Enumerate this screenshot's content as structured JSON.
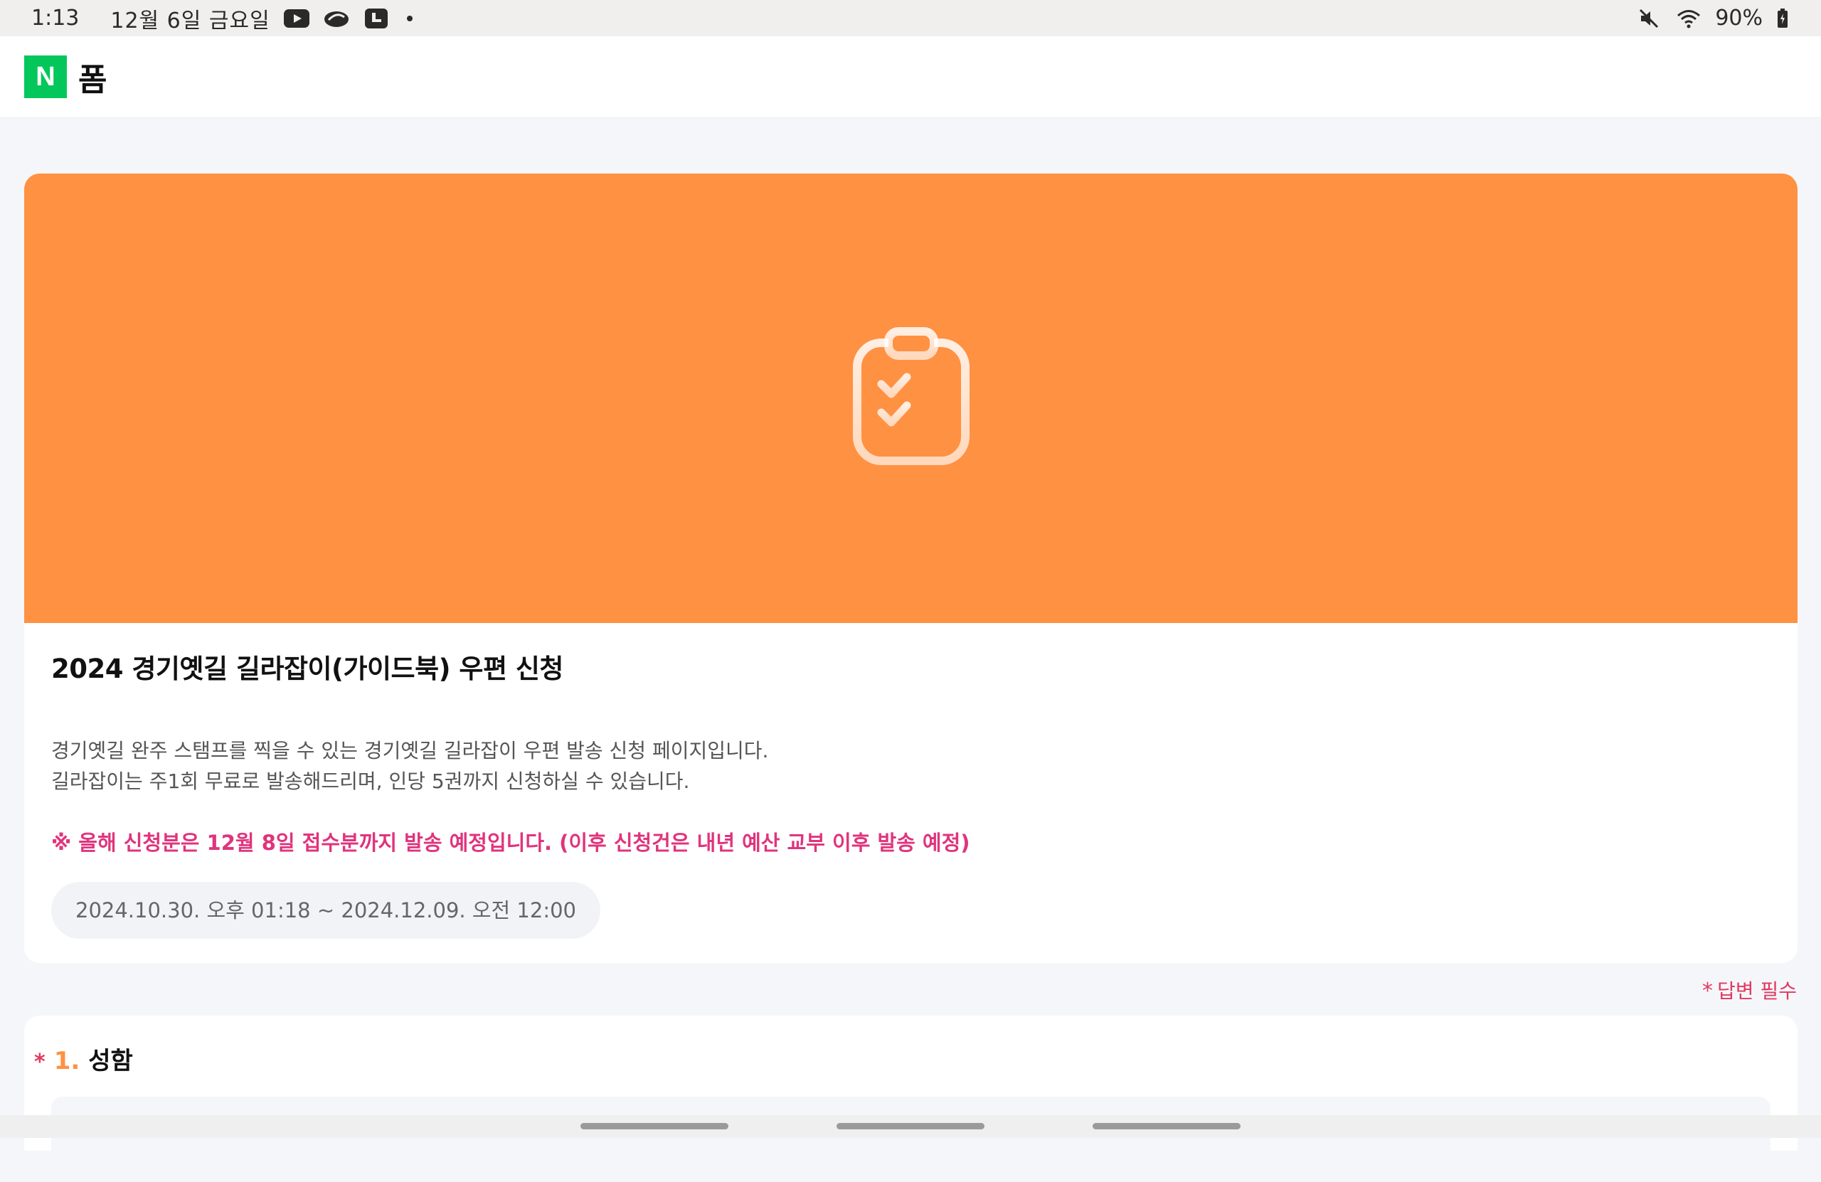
{
  "status_bar": {
    "time": "1:13",
    "date": "12월 6일 금요일",
    "battery": "90%",
    "app_icons": [
      "youtube-icon",
      "cloud-app-icon",
      "media-app-icon"
    ],
    "status_icons": [
      "mute-icon",
      "wifi-icon",
      "battery-icon"
    ]
  },
  "app_bar": {
    "logo_letter": "N",
    "title": "폼",
    "logo_color": "#03c75a"
  },
  "form": {
    "banner_color": "#ff9142",
    "banner_icon": "clipboard-checklist-icon",
    "title": "2024 경기옛길 길라잡이(가이드북) 우편 신청",
    "description_lines": [
      "경기옛길 완주 스탬프를 찍을 수 있는 경기옛길 길라잡이 우편 발송 신청 페이지입니다.",
      "길라잡이는 주1회 무료로 발송해드리며, 인당 5권까지 신청하실 수 있습니다."
    ],
    "notice": "※ 올해 신청분은 12월 8일 접수분까지 발송 예정입니다. (이후 신청건은 내년 예산 교부 이후 발송 예정)",
    "period": "2024.10.30. 오후 01:18 ~ 2024.12.09. 오전 12:00",
    "notice_color": "#e0347d"
  },
  "required_note": {
    "star": "*",
    "label": "답변 필수"
  },
  "questions": [
    {
      "star": "*",
      "number": "1.",
      "label": "성함"
    }
  ]
}
